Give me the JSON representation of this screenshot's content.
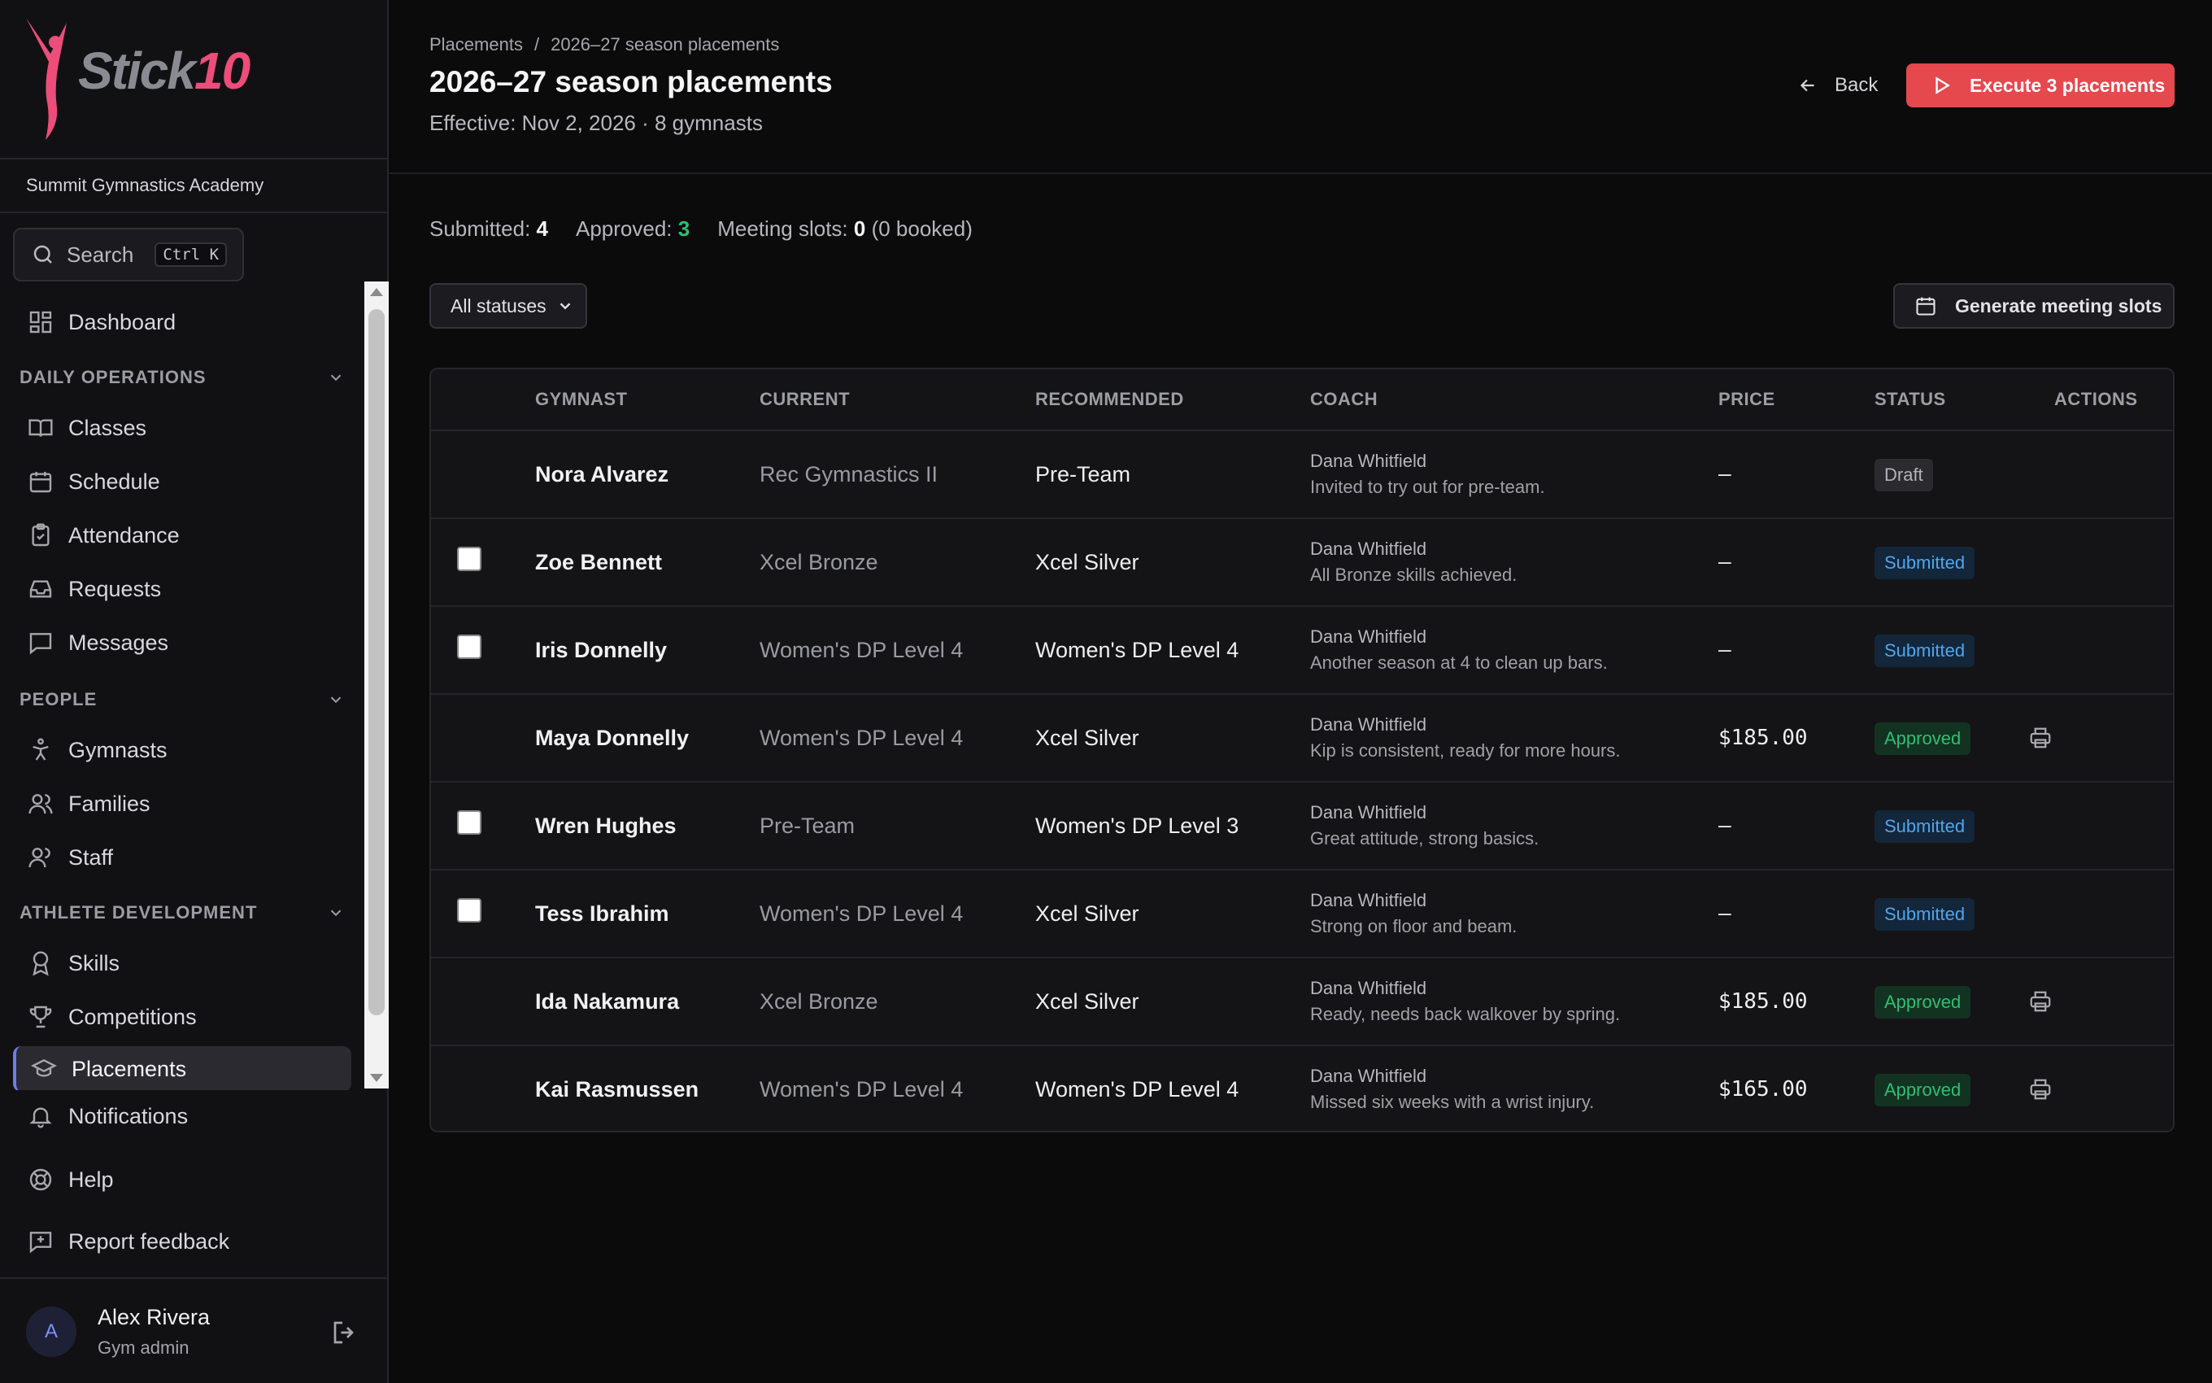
{
  "brand": {
    "logo_word": "Stick",
    "logo_num": "10",
    "accent": "#ec4d7a"
  },
  "org": {
    "name": "Summit Gymnastics Academy"
  },
  "search": {
    "label": "Search",
    "shortcut": "Ctrl K"
  },
  "sidebar": {
    "dashboard": {
      "label": "Dashboard",
      "icon": "dashboard-icon"
    },
    "sections": [
      {
        "title": "DAILY OPERATIONS",
        "items": [
          {
            "label": "Classes",
            "icon": "book-icon"
          },
          {
            "label": "Schedule",
            "icon": "calendar-icon"
          },
          {
            "label": "Attendance",
            "icon": "clipboard-check-icon"
          },
          {
            "label": "Requests",
            "icon": "inbox-icon"
          },
          {
            "label": "Messages",
            "icon": "message-icon"
          }
        ]
      },
      {
        "title": "PEOPLE",
        "items": [
          {
            "label": "Gymnasts",
            "icon": "person-stretch-icon"
          },
          {
            "label": "Families",
            "icon": "users-icon"
          },
          {
            "label": "Staff",
            "icon": "staff-icon"
          }
        ]
      },
      {
        "title": "ATHLETE DEVELOPMENT",
        "items": [
          {
            "label": "Skills",
            "icon": "award-icon"
          },
          {
            "label": "Competitions",
            "icon": "trophy-icon"
          },
          {
            "label": "Placements",
            "icon": "graduation-cap-icon",
            "active": true
          }
        ]
      }
    ],
    "footer_items": [
      {
        "label": "Notifications",
        "icon": "bell-icon"
      },
      {
        "label": "Help",
        "icon": "lifebuoy-icon"
      },
      {
        "label": "Report feedback",
        "icon": "feedback-icon"
      }
    ]
  },
  "user": {
    "initial": "A",
    "name": "Alex Rivera",
    "role": "Gym admin"
  },
  "header": {
    "breadcrumb": [
      "Placements",
      "/",
      "2026–27 season placements"
    ],
    "title": "2026–27 season placements",
    "subtitle": "Effective: Nov 2, 2026 · 8 gymnasts",
    "back_label": "Back",
    "execute_label": "Execute 3 placements"
  },
  "stats": {
    "submitted_label": "Submitted:",
    "submitted": "4",
    "approved_label": "Approved:",
    "approved": "3",
    "slots_label": "Meeting slots:",
    "slots": "0",
    "slots_booked": "(0 booked)"
  },
  "filter": {
    "selected": "All statuses"
  },
  "generate_label": "Generate meeting slots",
  "table": {
    "columns": [
      "GYMNAST",
      "CURRENT",
      "RECOMMENDED",
      "COACH",
      "PRICE",
      "STATUS",
      "ACTIONS"
    ],
    "rows": [
      {
        "name": "Nora Alvarez",
        "current": "Rec Gymnastics II",
        "recommended": "Pre-Team",
        "coach": "Dana Whitfield",
        "note": "Invited to try out for pre-team.",
        "price": "–",
        "status": "Draft",
        "checkbox": false,
        "print": false
      },
      {
        "name": "Zoe Bennett",
        "current": "Xcel Bronze",
        "recommended": "Xcel Silver",
        "coach": "Dana Whitfield",
        "note": "All Bronze skills achieved.",
        "price": "–",
        "status": "Submitted",
        "checkbox": true,
        "print": false
      },
      {
        "name": "Iris Donnelly",
        "current": "Women's DP Level 4",
        "recommended": "Women's DP Level 4",
        "coach": "Dana Whitfield",
        "note": "Another season at 4 to clean up bars.",
        "price": "–",
        "status": "Submitted",
        "checkbox": true,
        "print": false
      },
      {
        "name": "Maya Donnelly",
        "current": "Women's DP Level 4",
        "recommended": "Xcel Silver",
        "coach": "Dana Whitfield",
        "note": "Kip is consistent, ready for more hours.",
        "price": "$185.00",
        "status": "Approved",
        "checkbox": false,
        "print": true
      },
      {
        "name": "Wren Hughes",
        "current": "Pre-Team",
        "recommended": "Women's DP Level 3",
        "coach": "Dana Whitfield",
        "note": "Great attitude, strong basics.",
        "price": "–",
        "status": "Submitted",
        "checkbox": true,
        "print": false
      },
      {
        "name": "Tess Ibrahim",
        "current": "Women's DP Level 4",
        "recommended": "Xcel Silver",
        "coach": "Dana Whitfield",
        "note": "Strong on floor and beam.",
        "price": "–",
        "status": "Submitted",
        "checkbox": true,
        "print": false
      },
      {
        "name": "Ida Nakamura",
        "current": "Xcel Bronze",
        "recommended": "Xcel Silver",
        "coach": "Dana Whitfield",
        "note": "Ready, needs back walkover by spring.",
        "price": "$185.00",
        "status": "Approved",
        "checkbox": false,
        "print": true
      },
      {
        "name": "Kai Rasmussen",
        "current": "Women's DP Level 4",
        "recommended": "Women's DP Level 4",
        "coach": "Dana Whitfield",
        "note": "Missed six weeks with a wrist injury.",
        "price": "$165.00",
        "status": "Approved",
        "checkbox": false,
        "print": true
      }
    ]
  }
}
